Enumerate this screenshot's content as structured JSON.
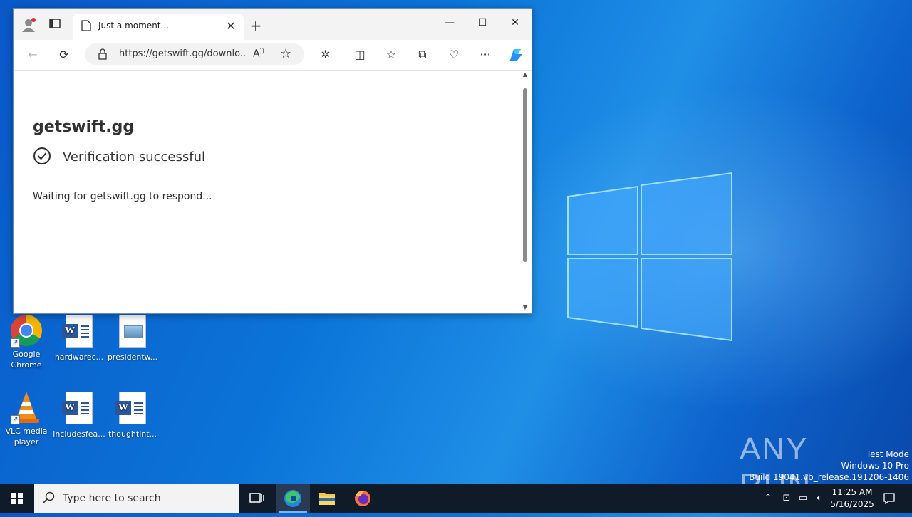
{
  "desktop": {
    "icons": [
      {
        "label": "Google Chrome"
      },
      {
        "label": "hardwarec..."
      },
      {
        "label": "presidentw..."
      },
      {
        "label": "VLC media player"
      },
      {
        "label": "includesfea..."
      },
      {
        "label": "thoughtint..."
      }
    ]
  },
  "browser": {
    "tab_title": "Just a moment...",
    "address": "https://getswift.gg/downlo...",
    "page": {
      "site": "getswift.gg",
      "verify_text": "Verification successful",
      "waiting_text": "Waiting for getswift.gg to respond..."
    }
  },
  "watermark": {
    "brand": "ANY RUN",
    "test_mode": "Test Mode",
    "os": "Windows 10 Pro",
    "build": "Build 19041.vb_release.191206-1406"
  },
  "taskbar": {
    "search_placeholder": "Type here to search",
    "time": "11:25 AM",
    "date": "5/16/2025"
  },
  "colors": {
    "accent": "#0a58c8",
    "taskbar": "#101b2a",
    "word_blue": "#2b579a"
  }
}
